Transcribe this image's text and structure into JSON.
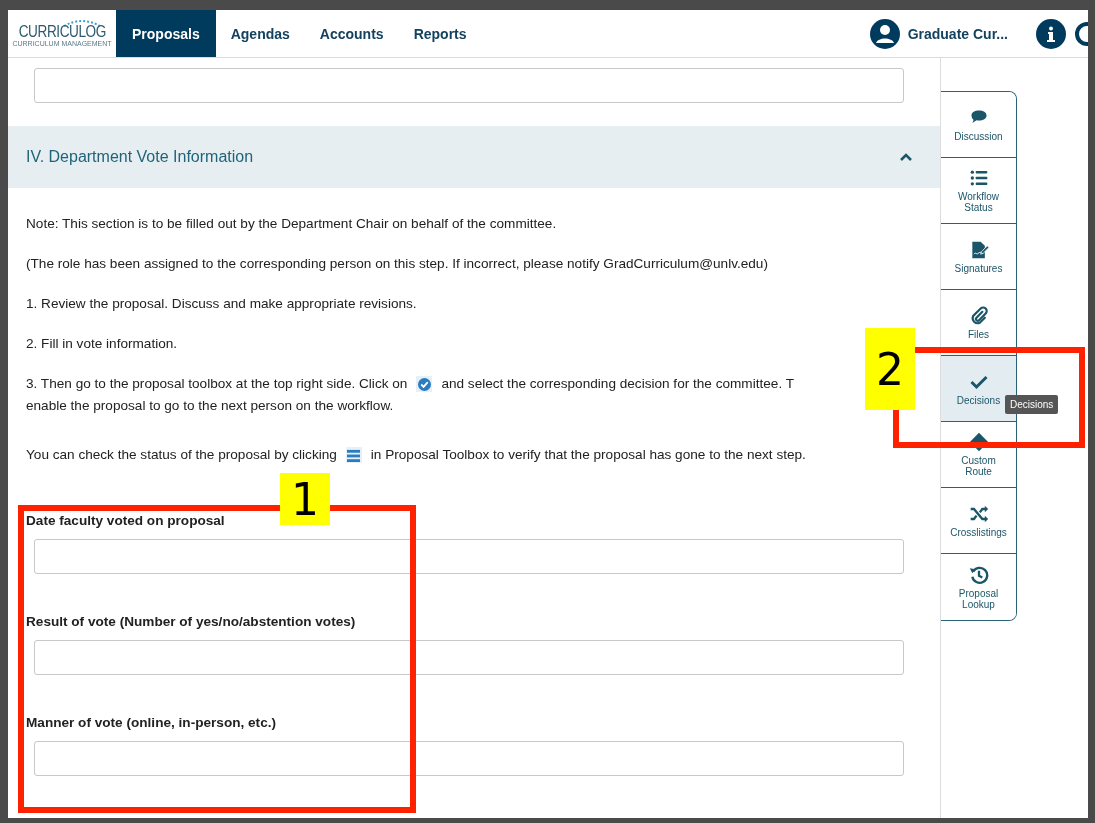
{
  "nav": {
    "logo": {
      "name": "CURRICULOG",
      "tagline": "CURRICULUM MANAGEMENT"
    },
    "tabs": [
      {
        "label": "Proposals",
        "selected": true
      },
      {
        "label": "Agendas",
        "selected": false
      },
      {
        "label": "Accounts",
        "selected": false
      },
      {
        "label": "Reports",
        "selected": false
      }
    ],
    "user": "Graduate Cur..."
  },
  "section": {
    "title": "IV. Department Vote Information",
    "expanded": true,
    "paragraphs": [
      {
        "parts": [
          "Note: This section is to be filled out by the Department Chair on behalf of the committee."
        ]
      },
      {
        "parts": [
          "(The role has been assigned to the corresponding person on this step. If incorrect, please notify GradCurriculum@unlv.edu)"
        ]
      },
      {
        "parts": [
          "1. Review the proposal. Discuss and make appropriate revisions."
        ]
      },
      {
        "parts": [
          "2. Fill in vote information."
        ]
      },
      {
        "parts": [
          "3. Then go to the proposal toolbox at the top right side. Click on",
          "and select the corresponding decision for the committee. T"
        ],
        "kind": "check",
        "continuation": "enable the proposal to go to the next person on the workflow."
      },
      {
        "parts": [
          "You can check the status of the proposal by clicking",
          "in Proposal Toolbox to verify that the proposal has gone to the next step."
        ],
        "kind": "list"
      }
    ],
    "fields": [
      {
        "label": "Date faculty voted on proposal"
      },
      {
        "label": "Result of vote (Number of yes/no/abstention votes)"
      },
      {
        "label": "Manner of vote (online, in-person, etc.)"
      }
    ]
  },
  "toolbox": [
    {
      "label": "Discussion",
      "kind": "chat",
      "selected": false
    },
    {
      "label": "Workflow Status",
      "kind": "list",
      "selected": false
    },
    {
      "label": "Signatures",
      "kind": "sign",
      "selected": false
    },
    {
      "label": "Files",
      "kind": "clip",
      "selected": false
    },
    {
      "label": "Decisions",
      "kind": "check",
      "selected": true
    },
    {
      "label": "Custom Route",
      "kind": "route",
      "selected": false
    },
    {
      "label": "Crosslistings",
      "kind": "shuffle",
      "selected": false
    },
    {
      "label": "Proposal Lookup",
      "kind": "history",
      "selected": false
    }
  ],
  "tooltip": "Decisions",
  "annotations": [
    {
      "label": "1"
    },
    {
      "label": "2"
    }
  ]
}
